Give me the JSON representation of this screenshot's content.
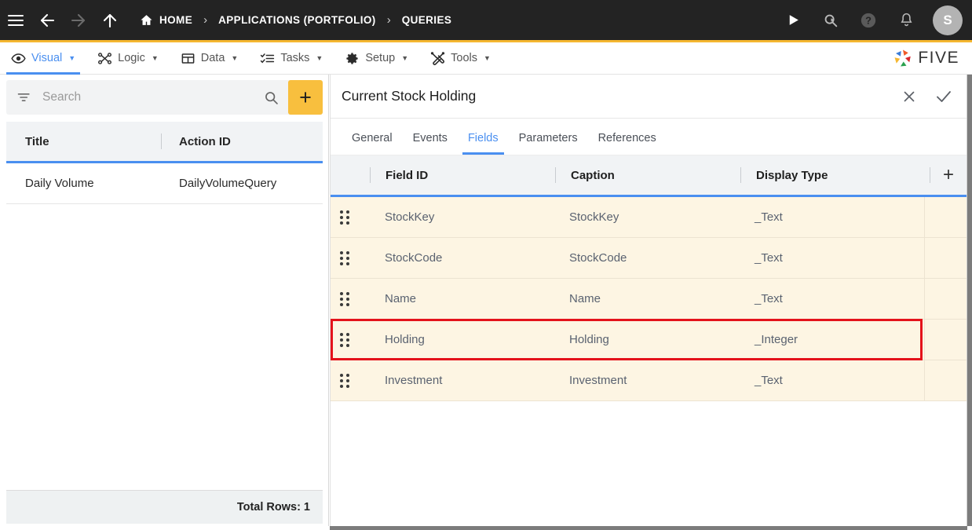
{
  "topbar": {
    "icons": {
      "menu": "hamburger-menu-icon",
      "back": "back-arrow-icon",
      "forward": "forward-arrow-icon",
      "up": "up-arrow-icon",
      "run": "play-icon",
      "search": "search-magnifier-icon",
      "help": "help-circle-icon",
      "notifications": "bell-icon"
    },
    "breadcrumbs": [
      {
        "label": "HOME",
        "icon": "home-icon"
      },
      {
        "label": "APPLICATIONS (PORTFOLIO)",
        "icon": ""
      },
      {
        "label": "QUERIES",
        "icon": ""
      }
    ],
    "separator": "›",
    "avatar_initial": "S",
    "accent_underline": "#f5b731",
    "background": "#232323"
  },
  "menubar": {
    "items": [
      {
        "label": "Visual",
        "icon": "eye-icon",
        "active": true
      },
      {
        "label": "Logic",
        "icon": "workflow-icon",
        "active": false
      },
      {
        "label": "Data",
        "icon": "table-grid-icon",
        "active": false
      },
      {
        "label": "Tasks",
        "icon": "checklist-icon",
        "active": false
      },
      {
        "label": "Setup",
        "icon": "gear-icon",
        "active": false
      },
      {
        "label": "Tools",
        "icon": "tools-icon",
        "active": false
      }
    ],
    "caret": "▼",
    "brand": "FIVE",
    "active_color": "#4a8ff0"
  },
  "sidebar": {
    "search": {
      "placeholder": "Search",
      "value": "",
      "filter_icon": "filter-icon",
      "search_icon": "search-icon"
    },
    "add_button_label": "+",
    "add_button_color": "#f8bf3e",
    "columns": [
      "Title",
      "Action ID"
    ],
    "rows": [
      {
        "title": "Daily Volume",
        "action_id": "DailyVolumeQuery"
      }
    ],
    "footer": "Total Rows: 1"
  },
  "panel": {
    "title": "Current Stock Holding",
    "actions": [
      {
        "name": "close-icon",
        "glyph": "×"
      },
      {
        "name": "confirm-check-icon",
        "glyph": "✓"
      }
    ],
    "tabs": [
      {
        "label": "General",
        "active": false
      },
      {
        "label": "Events",
        "active": false
      },
      {
        "label": "Fields",
        "active": true
      },
      {
        "label": "Parameters",
        "active": false
      },
      {
        "label": "References",
        "active": false
      }
    ],
    "grid": {
      "columns": [
        "Field ID",
        "Caption",
        "Display Type"
      ],
      "add_column_label": "+",
      "rows": [
        {
          "field_id": "StockKey",
          "caption": "StockKey",
          "display_type": "_Text",
          "highlighted": false
        },
        {
          "field_id": "StockCode",
          "caption": "StockCode",
          "display_type": "_Text",
          "highlighted": false
        },
        {
          "field_id": "Name",
          "caption": "Name",
          "display_type": "_Text",
          "highlighted": false
        },
        {
          "field_id": "Holding",
          "caption": "Holding",
          "display_type": "_Integer",
          "highlighted": true
        },
        {
          "field_id": "Investment",
          "caption": "Investment",
          "display_type": "_Text",
          "highlighted": false
        }
      ],
      "row_background": "#fdf5e3",
      "highlight_color": "#e4121b",
      "header_underline": "#4a8ff0"
    }
  }
}
